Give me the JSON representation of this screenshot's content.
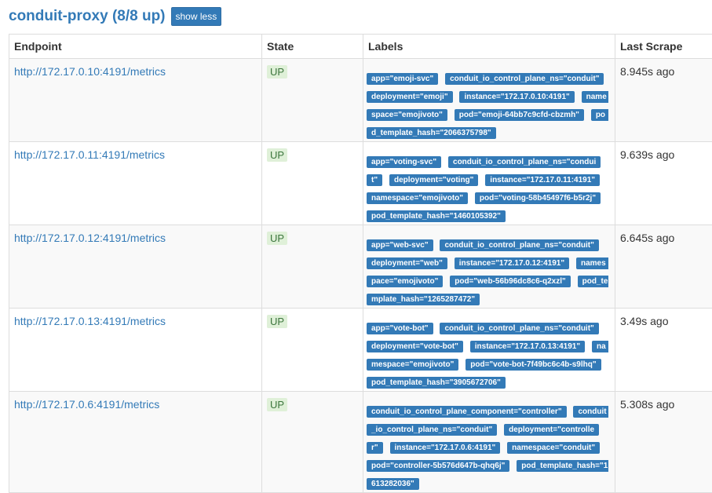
{
  "header": {
    "title": "conduit-proxy (8/8 up)",
    "toggle_label": "show less"
  },
  "table": {
    "columns": [
      "Endpoint",
      "State",
      "Labels",
      "Last Scrape"
    ],
    "rows": [
      {
        "endpoint": "http://172.17.0.10:4191/metrics",
        "state": "UP",
        "labels": [
          "app=\"emoji-svc\"",
          "conduit_io_control_plane_ns=\"conduit\"",
          "deployment=\"emoji\"",
          "instance=\"172.17.0.10:4191\"",
          "namespace=\"emojivoto\"",
          "pod=\"emoji-64bb7c9cfd-cbzmh\"",
          "pod_template_hash=\"2066375798\""
        ],
        "last_scrape": "8.945s ago"
      },
      {
        "endpoint": "http://172.17.0.11:4191/metrics",
        "state": "UP",
        "labels": [
          "app=\"voting-svc\"",
          "conduit_io_control_plane_ns=\"conduit\"",
          "deployment=\"voting\"",
          "instance=\"172.17.0.11:4191\"",
          "namespace=\"emojivoto\"",
          "pod=\"voting-58b45497f6-b5r2j\"",
          "pod_template_hash=\"1460105392\""
        ],
        "last_scrape": "9.639s ago"
      },
      {
        "endpoint": "http://172.17.0.12:4191/metrics",
        "state": "UP",
        "labels": [
          "app=\"web-svc\"",
          "conduit_io_control_plane_ns=\"conduit\"",
          "deployment=\"web\"",
          "instance=\"172.17.0.12:4191\"",
          "namespace=\"emojivoto\"",
          "pod=\"web-56b96dc8c6-q2xzl\"",
          "pod_template_hash=\"1265287472\""
        ],
        "last_scrape": "6.645s ago"
      },
      {
        "endpoint": "http://172.17.0.13:4191/metrics",
        "state": "UP",
        "labels": [
          "app=\"vote-bot\"",
          "conduit_io_control_plane_ns=\"conduit\"",
          "deployment=\"vote-bot\"",
          "instance=\"172.17.0.13:4191\"",
          "namespace=\"emojivoto\"",
          "pod=\"vote-bot-7f49bc6c4b-s9lhq\"",
          "pod_template_hash=\"3905672706\""
        ],
        "last_scrape": "3.49s ago"
      },
      {
        "endpoint": "http://172.17.0.6:4191/metrics",
        "state": "UP",
        "labels": [
          "conduit_io_control_plane_component=\"controller\"",
          "conduit_io_control_plane_ns=\"conduit\"",
          "deployment=\"controller\"",
          "instance=\"172.17.0.6:4191\"",
          "namespace=\"conduit\"",
          "pod=\"controller-5b576d647b-qhq6j\"",
          "pod_template_hash=\"1613282036\""
        ],
        "last_scrape": "5.308s ago"
      }
    ]
  }
}
